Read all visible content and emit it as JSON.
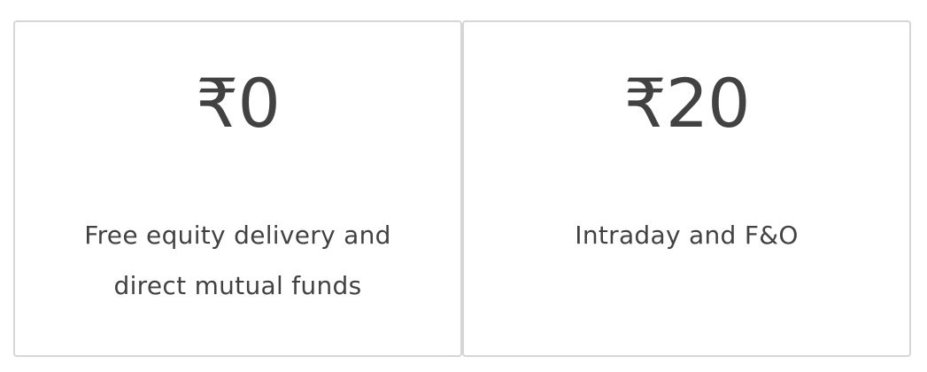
{
  "pricing": {
    "cards": [
      {
        "price": "₹0",
        "description": "Free equity delivery and direct mutual funds"
      },
      {
        "price": "₹20",
        "description": "Intraday and F&O"
      }
    ]
  },
  "colors": {
    "text": "#424242",
    "border": "#d6d6d6",
    "background": "#ffffff"
  }
}
